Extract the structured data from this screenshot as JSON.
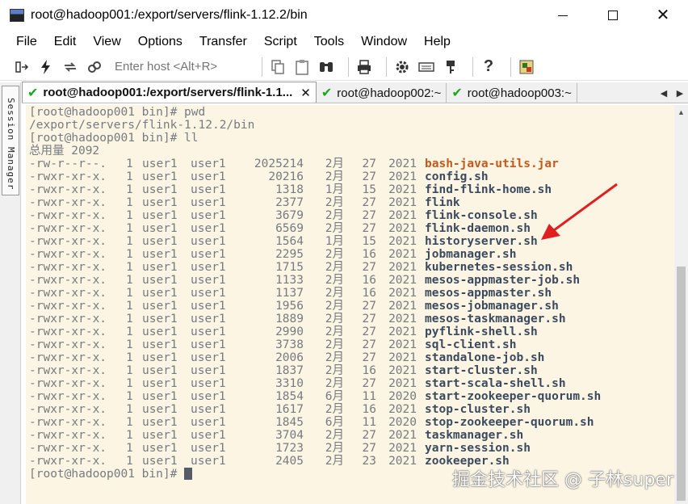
{
  "window": {
    "title": "root@hadoop001:/export/servers/flink-1.12.2/bin",
    "min_glyph": "—",
    "max_glyph": "☐",
    "close_glyph": "✕"
  },
  "menu": [
    "File",
    "Edit",
    "View",
    "Options",
    "Transfer",
    "Script",
    "Tools",
    "Window",
    "Help"
  ],
  "toolbar": {
    "host_placeholder": "Enter host <Alt+R>",
    "icons": [
      "connect-icon",
      "lightning-icon",
      "reconnect-icon",
      "disconnect-icon",
      "copy-icon",
      "paste-icon",
      "find-icon",
      "print-icon",
      "settings-gear-icon",
      "keymap-icon",
      "key-icon",
      "help-icon",
      "sftp-icon"
    ]
  },
  "session_manager": {
    "label": "Session Manager"
  },
  "tabs": [
    {
      "label": "root@hadoop001:/export/servers/flink-1.1...",
      "active": true,
      "close": "✕"
    },
    {
      "label": "root@hadoop002:~",
      "active": false
    },
    {
      "label": "root@hadoop003:~",
      "active": false
    }
  ],
  "terminal": {
    "lines_before": [
      "[root@hadoop001 bin]# pwd",
      "/export/servers/flink-1.12.2/bin",
      "[root@hadoop001 bin]# ll",
      "总用量 2092"
    ],
    "listing": [
      {
        "perm": "-rw-r--r--.",
        "links": "1",
        "user": "user1",
        "group": "user1",
        "size": "2025214",
        "month": "2月",
        "day": "27",
        "year": "2021",
        "name": "bash-java-utils.jar",
        "jar": true
      },
      {
        "perm": "-rwxr-xr-x.",
        "links": "1",
        "user": "user1",
        "group": "user1",
        "size": "20216",
        "month": "2月",
        "day": "27",
        "year": "2021",
        "name": "config.sh"
      },
      {
        "perm": "-rwxr-xr-x.",
        "links": "1",
        "user": "user1",
        "group": "user1",
        "size": "1318",
        "month": "1月",
        "day": "15",
        "year": "2021",
        "name": "find-flink-home.sh"
      },
      {
        "perm": "-rwxr-xr-x.",
        "links": "1",
        "user": "user1",
        "group": "user1",
        "size": "2377",
        "month": "2月",
        "day": "27",
        "year": "2021",
        "name": "flink"
      },
      {
        "perm": "-rwxr-xr-x.",
        "links": "1",
        "user": "user1",
        "group": "user1",
        "size": "3679",
        "month": "2月",
        "day": "27",
        "year": "2021",
        "name": "flink-console.sh"
      },
      {
        "perm": "-rwxr-xr-x.",
        "links": "1",
        "user": "user1",
        "group": "user1",
        "size": "6569",
        "month": "2月",
        "day": "27",
        "year": "2021",
        "name": "flink-daemon.sh"
      },
      {
        "perm": "-rwxr-xr-x.",
        "links": "1",
        "user": "user1",
        "group": "user1",
        "size": "1564",
        "month": "1月",
        "day": "15",
        "year": "2021",
        "name": "historyserver.sh"
      },
      {
        "perm": "-rwxr-xr-x.",
        "links": "1",
        "user": "user1",
        "group": "user1",
        "size": "2295",
        "month": "2月",
        "day": "16",
        "year": "2021",
        "name": "jobmanager.sh"
      },
      {
        "perm": "-rwxr-xr-x.",
        "links": "1",
        "user": "user1",
        "group": "user1",
        "size": "1715",
        "month": "2月",
        "day": "27",
        "year": "2021",
        "name": "kubernetes-session.sh"
      },
      {
        "perm": "-rwxr-xr-x.",
        "links": "1",
        "user": "user1",
        "group": "user1",
        "size": "1133",
        "month": "2月",
        "day": "16",
        "year": "2021",
        "name": "mesos-appmaster-job.sh"
      },
      {
        "perm": "-rwxr-xr-x.",
        "links": "1",
        "user": "user1",
        "group": "user1",
        "size": "1137",
        "month": "2月",
        "day": "16",
        "year": "2021",
        "name": "mesos-appmaster.sh"
      },
      {
        "perm": "-rwxr-xr-x.",
        "links": "1",
        "user": "user1",
        "group": "user1",
        "size": "1956",
        "month": "2月",
        "day": "27",
        "year": "2021",
        "name": "mesos-jobmanager.sh"
      },
      {
        "perm": "-rwxr-xr-x.",
        "links": "1",
        "user": "user1",
        "group": "user1",
        "size": "1889",
        "month": "2月",
        "day": "27",
        "year": "2021",
        "name": "mesos-taskmanager.sh"
      },
      {
        "perm": "-rwxr-xr-x.",
        "links": "1",
        "user": "user1",
        "group": "user1",
        "size": "2990",
        "month": "2月",
        "day": "27",
        "year": "2021",
        "name": "pyflink-shell.sh"
      },
      {
        "perm": "-rwxr-xr-x.",
        "links": "1",
        "user": "user1",
        "group": "user1",
        "size": "3738",
        "month": "2月",
        "day": "27",
        "year": "2021",
        "name": "sql-client.sh"
      },
      {
        "perm": "-rwxr-xr-x.",
        "links": "1",
        "user": "user1",
        "group": "user1",
        "size": "2006",
        "month": "2月",
        "day": "27",
        "year": "2021",
        "name": "standalone-job.sh"
      },
      {
        "perm": "-rwxr-xr-x.",
        "links": "1",
        "user": "user1",
        "group": "user1",
        "size": "1837",
        "month": "2月",
        "day": "16",
        "year": "2021",
        "name": "start-cluster.sh"
      },
      {
        "perm": "-rwxr-xr-x.",
        "links": "1",
        "user": "user1",
        "group": "user1",
        "size": "3310",
        "month": "2月",
        "day": "27",
        "year": "2021",
        "name": "start-scala-shell.sh"
      },
      {
        "perm": "-rwxr-xr-x.",
        "links": "1",
        "user": "user1",
        "group": "user1",
        "size": "1854",
        "month": "6月",
        "day": "11",
        "year": "2020",
        "name": "start-zookeeper-quorum.sh"
      },
      {
        "perm": "-rwxr-xr-x.",
        "links": "1",
        "user": "user1",
        "group": "user1",
        "size": "1617",
        "month": "2月",
        "day": "16",
        "year": "2021",
        "name": "stop-cluster.sh"
      },
      {
        "perm": "-rwxr-xr-x.",
        "links": "1",
        "user": "user1",
        "group": "user1",
        "size": "1845",
        "month": "6月",
        "day": "11",
        "year": "2020",
        "name": "stop-zookeeper-quorum.sh"
      },
      {
        "perm": "-rwxr-xr-x.",
        "links": "1",
        "user": "user1",
        "group": "user1",
        "size": "3704",
        "month": "2月",
        "day": "27",
        "year": "2021",
        "name": "taskmanager.sh"
      },
      {
        "perm": "-rwxr-xr-x.",
        "links": "1",
        "user": "user1",
        "group": "user1",
        "size": "1723",
        "month": "2月",
        "day": "27",
        "year": "2021",
        "name": "yarn-session.sh"
      },
      {
        "perm": "-rwxr-xr-x.",
        "links": "1",
        "user": "user1",
        "group": "user1",
        "size": "2405",
        "month": "2月",
        "day": "23",
        "year": "2021",
        "name": "zookeeper.sh"
      }
    ],
    "prompt": "[root@hadoop001 bin]# "
  },
  "watermark": "掘金技术社区 @ 子林super",
  "colors": {
    "terminal_bg": "#fcf5e4",
    "terminal_text": "#777a80",
    "filename": "#3b4a5e",
    "jar": "#c4591b",
    "annotation_arrow": "#e02020",
    "check": "#1fa51f"
  }
}
